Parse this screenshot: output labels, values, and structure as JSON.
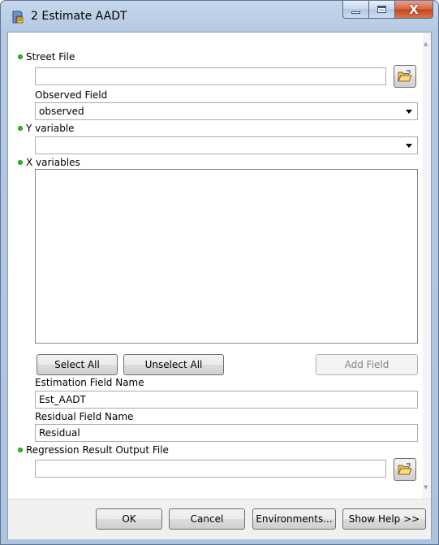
{
  "window": {
    "title": "2 Estimate AADT",
    "close_glyph": "X"
  },
  "form": {
    "street_file": {
      "label": "Street File",
      "value": ""
    },
    "observed_field": {
      "label": "Observed Field",
      "value": "observed"
    },
    "y_variable": {
      "label": "Y variable",
      "value": ""
    },
    "x_variables": {
      "label": "X variables",
      "items": []
    },
    "buttons": {
      "select_all": "Select All",
      "unselect_all": "Unselect All",
      "add_field": "Add Field"
    },
    "estimation_field": {
      "label": "Estimation Field Name",
      "value": "Est_AADT"
    },
    "residual_field": {
      "label": "Residual Field Name",
      "value": "Residual"
    },
    "regression_output": {
      "label": "Regression Result Output File",
      "value": ""
    }
  },
  "footer": {
    "ok": "OK",
    "cancel": "Cancel",
    "environments": "Environments...",
    "show_help": "Show Help >>"
  },
  "colors": {
    "required_dot": "#29c019",
    "frame": "#b4c8e2",
    "close_button": "#c8401c"
  },
  "icons": {
    "app": "tool-script-icon",
    "browse": "folder-open-icon"
  }
}
